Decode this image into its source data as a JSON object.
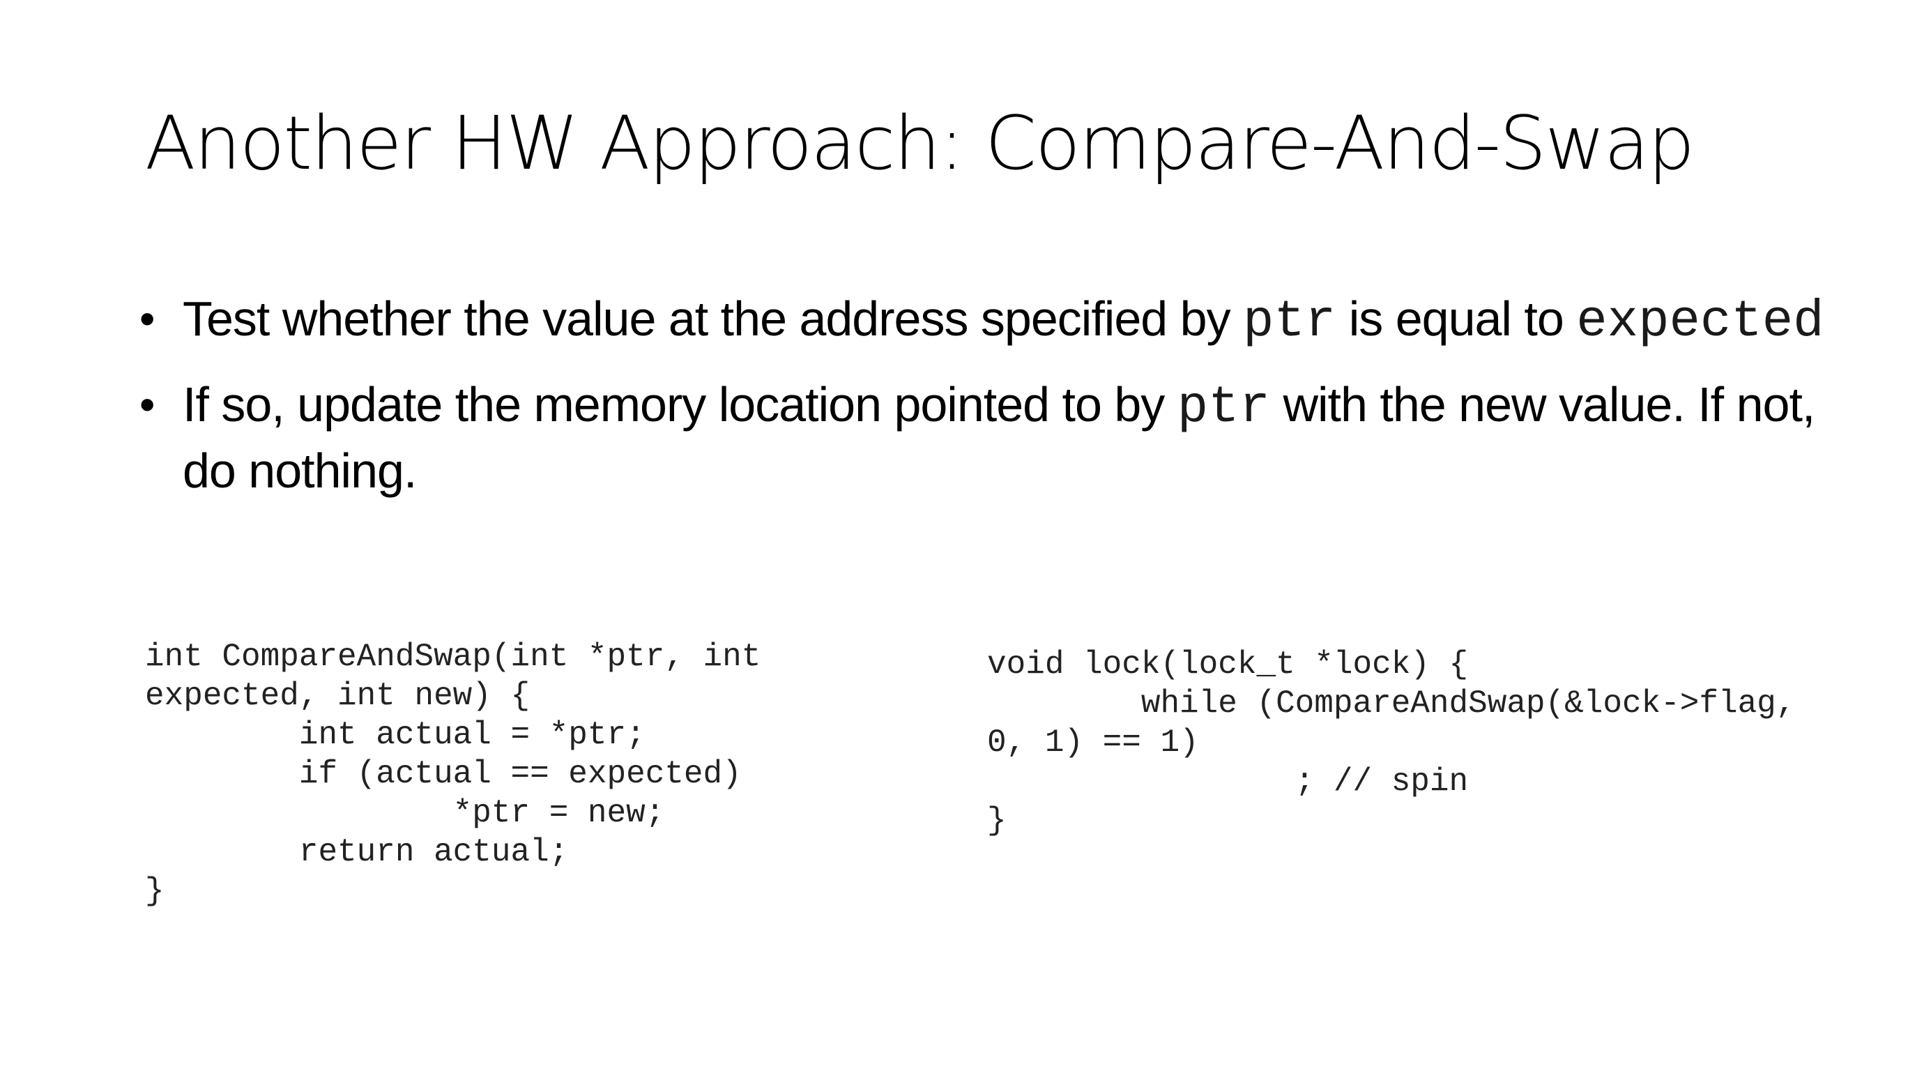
{
  "slide": {
    "title": "Another HW Approach: Compare-And-Swap",
    "bullets": [
      {
        "marker": "•",
        "text_before": "Test whether the value at the address specified by ",
        "code1": "ptr",
        "text_middle": " is equal to ",
        "code2": "expected"
      },
      {
        "marker": "•",
        "text_before": "If so, update the memory location pointed to by ",
        "code1": "ptr",
        "text_after": " with the new value. If not, do nothing."
      }
    ],
    "code_left": [
      "int CompareAndSwap(int *ptr, int",
      "expected, int new) {",
      "        int actual = *ptr;",
      "        if (actual == expected)",
      "                *ptr = new;",
      "        return actual;",
      "}"
    ],
    "code_right": [
      "void lock(lock_t *lock) {",
      "        while (CompareAndSwap(&lock->flag,",
      "0, 1) == 1)",
      "                ; // spin",
      "}"
    ]
  }
}
